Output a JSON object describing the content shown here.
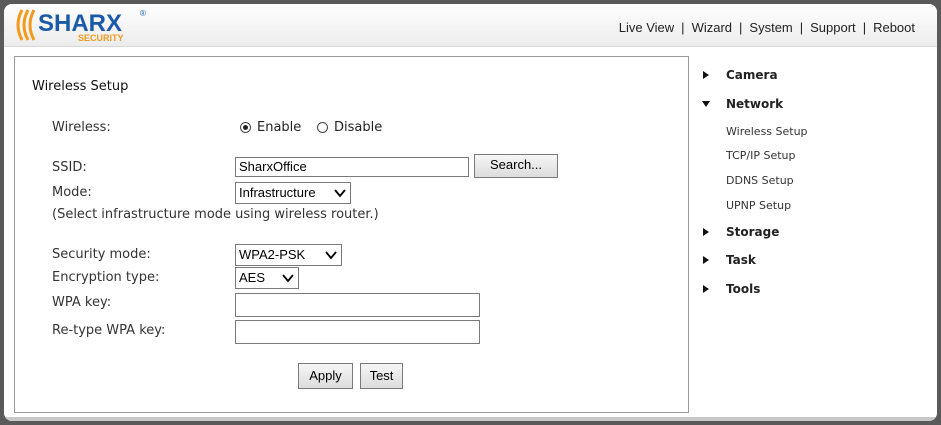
{
  "logo": {
    "brand": "SHARX",
    "tagline": "SECURITY"
  },
  "topnav": {
    "items": [
      "Live View",
      "Wizard",
      "System",
      "Support",
      "Reboot"
    ],
    "separator": "|"
  },
  "form": {
    "title": "Wireless Setup",
    "wireless_label": "Wireless:",
    "enable_label": "Enable",
    "disable_label": "Disable",
    "wireless_selected": "Enable",
    "ssid_label": "SSID:",
    "ssid_value": "SharxOffice",
    "search_button": "Search...",
    "mode_label": "Mode:",
    "mode_value": "Infrastructure",
    "mode_hint": "(Select infrastructure mode using wireless router.)",
    "security_label": "Security mode:",
    "security_value": "WPA2-PSK",
    "encryption_label": "Encryption type:",
    "encryption_value": "AES",
    "wpa_label": "WPA key:",
    "wpa_value": "",
    "retype_label": "Re-type WPA key:",
    "retype_value": "",
    "apply_button": "Apply",
    "test_button": "Test"
  },
  "sidebar": {
    "camera": "Camera",
    "network": "Network",
    "network_items": [
      "Wireless Setup",
      "TCP/IP Setup",
      "DDNS Setup",
      "UPNP Setup"
    ],
    "storage": "Storage",
    "task": "Task",
    "tools": "Tools"
  },
  "colors": {
    "brand_blue": "#1a5aa8",
    "brand_orange": "#f29a1e",
    "frame_bg": "#5a5a5a"
  }
}
